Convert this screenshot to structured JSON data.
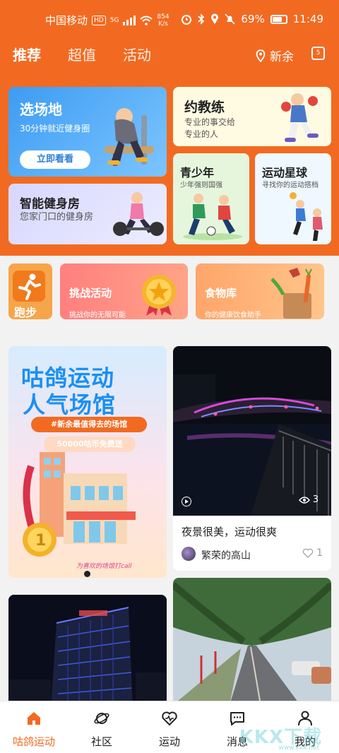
{
  "status_bar": {
    "carrier": "中国移动",
    "hd": "HD",
    "network": "5G",
    "speed_value": "854",
    "speed_unit": "K/s",
    "battery": "69%",
    "time": "11:49"
  },
  "header": {
    "tabs": [
      "推荐",
      "超值",
      "活动"
    ],
    "active_tab": "推荐",
    "location": "新余",
    "calendar_day": "5"
  },
  "cards": {
    "venue": {
      "title": "选场地",
      "subtitle": "30分钟就近健身圈",
      "button": "立即看看"
    },
    "coach": {
      "title": "约教练",
      "subtitle_line1": "专业的事交给",
      "subtitle_line2": "专业的人"
    },
    "gym": {
      "title": "智能健身房",
      "subtitle": "您家门口的健身房"
    },
    "youth": {
      "title": "青少年",
      "subtitle": "少年强则国强"
    },
    "star": {
      "title": "运动星球",
      "subtitle": "寻找你的运动搭档"
    }
  },
  "quick": {
    "run": {
      "label": "跑步"
    },
    "challenge": {
      "title": "挑战活动",
      "subtitle": "挑战你的无限可能"
    },
    "food": {
      "title": "食物库",
      "subtitle": "你的健康饮食助手"
    }
  },
  "feed": {
    "promo": {
      "title_line1": "咕鸽运动",
      "title_line2": "人气场馆",
      "pill": "#新余最值得去的场馆",
      "coins": "50000咕币免费送",
      "footer": "为喜欢的场馆打call"
    },
    "post": {
      "title": "夜景很美，运动很爽",
      "author": "繁荣的高山",
      "views": "3",
      "likes": "1"
    }
  },
  "bottom_nav": {
    "items": [
      "咕鸽运动",
      "社区",
      "运动",
      "消息",
      "我的"
    ],
    "active": "咕鸽运动"
  },
  "watermark": {
    "text": "KKX下载",
    "url": "www.kkx.net"
  },
  "colors": {
    "brand": "#f26a21",
    "venue_blue": "#3d9cf2"
  }
}
